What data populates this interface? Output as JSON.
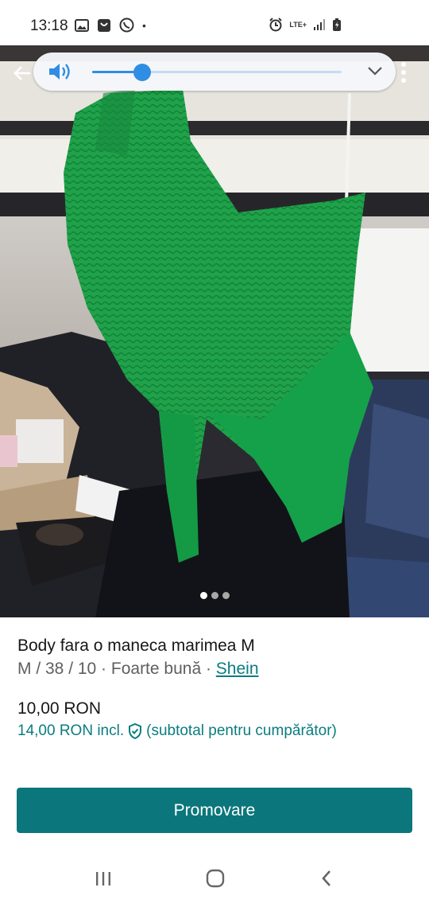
{
  "status_bar": {
    "time": "13:18",
    "left_icons": [
      "image-icon",
      "shopping-bag-icon",
      "whatsapp-icon"
    ],
    "dot": "•",
    "right_icons": [
      "alarm-icon",
      "lte-icon",
      "signal-icon",
      "battery-charging-icon"
    ],
    "network": "LTE+"
  },
  "volume_panel": {
    "level": 0.2,
    "accent_color": "#2f8ee3"
  },
  "carousel": {
    "count": 3,
    "active_index": 0
  },
  "item": {
    "title": "Body fara o maneca marimea M",
    "meta_prefix": "M / 38 / 10 · Foarte bună · ",
    "brand": "Shein",
    "price": "10,00 RON",
    "price_incl": "14,00 RON incl.",
    "buyer_note": "(subtotal pentru cumpărător)"
  },
  "actions": {
    "promote_label": "Promovare"
  },
  "colors": {
    "accent": "#0b767b",
    "link": "#0a7c80"
  }
}
